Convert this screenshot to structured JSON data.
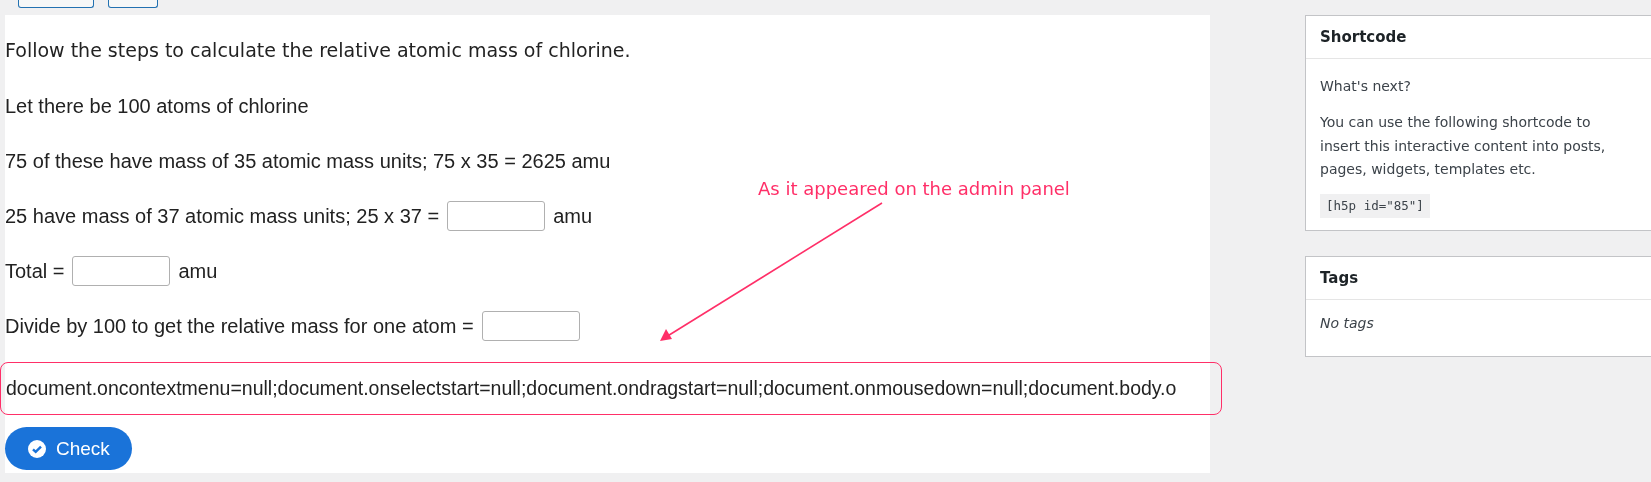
{
  "heading": "Follow the steps to calculate the relative atomic mass of chlorine.",
  "steps": [
    {
      "parts": [
        {
          "kind": "text",
          "text": "Let there be 100 atoms of chlorine"
        }
      ]
    },
    {
      "parts": [
        {
          "kind": "text",
          "text": "75 of these have mass of 35 atomic mass units; 75 x 35 = 2625 amu"
        }
      ]
    },
    {
      "parts": [
        {
          "kind": "text",
          "text": "25 have mass of 37 atomic mass units; 25 x 37 ="
        },
        {
          "kind": "blank"
        },
        {
          "kind": "text",
          "text": "amu"
        }
      ]
    },
    {
      "parts": [
        {
          "kind": "text",
          "text": "Total ="
        },
        {
          "kind": "blank"
        },
        {
          "kind": "text",
          "text": "amu"
        }
      ]
    },
    {
      "parts": [
        {
          "kind": "text",
          "text": "Divide by 100 to get the relative mass for one atom ="
        },
        {
          "kind": "blank"
        }
      ]
    }
  ],
  "code_line": "document.oncontextmenu=null;document.onselectstart=null;document.ondragstart=null;document.onmousedown=null;document.body.o",
  "annotation": "As it appeared on the admin panel",
  "check_button": "Check",
  "shortcode": {
    "title": "Shortcode",
    "subtitle": "What's next?",
    "text": "You can use the following shortcode to insert this interactive content into posts, pages, widgets, templates etc.",
    "code": "[h5p id=\"85\"]"
  },
  "tags": {
    "title": "Tags",
    "empty": "No tags"
  }
}
